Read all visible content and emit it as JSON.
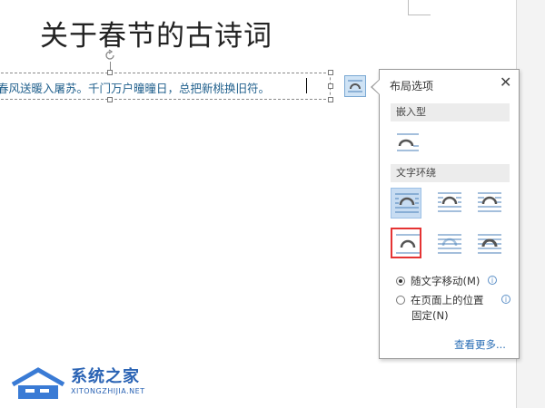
{
  "document": {
    "title": "关于春节的古诗词",
    "textbox_text": "春风送暖入屠苏。千门万户曈曈日，总把新桃换旧符。"
  },
  "layout_panel": {
    "title": "布局选项",
    "close_label": "✕",
    "section_inline": "嵌入型",
    "section_wrap": "文字环绕",
    "radio_move_with_text": "随文字移动(M)",
    "radio_fixed_position_line1": "在页面上的位置",
    "radio_fixed_position_line2": "固定(N)",
    "info_symbol": "i",
    "see_more": "查看更多..."
  },
  "watermark": {
    "name": "系统之家",
    "url": "XITONGZHIJIA.NET"
  },
  "colors": {
    "accent": "#2a6eb5",
    "selected_bg": "#c7dcf2",
    "highlight_border": "#e53333"
  }
}
